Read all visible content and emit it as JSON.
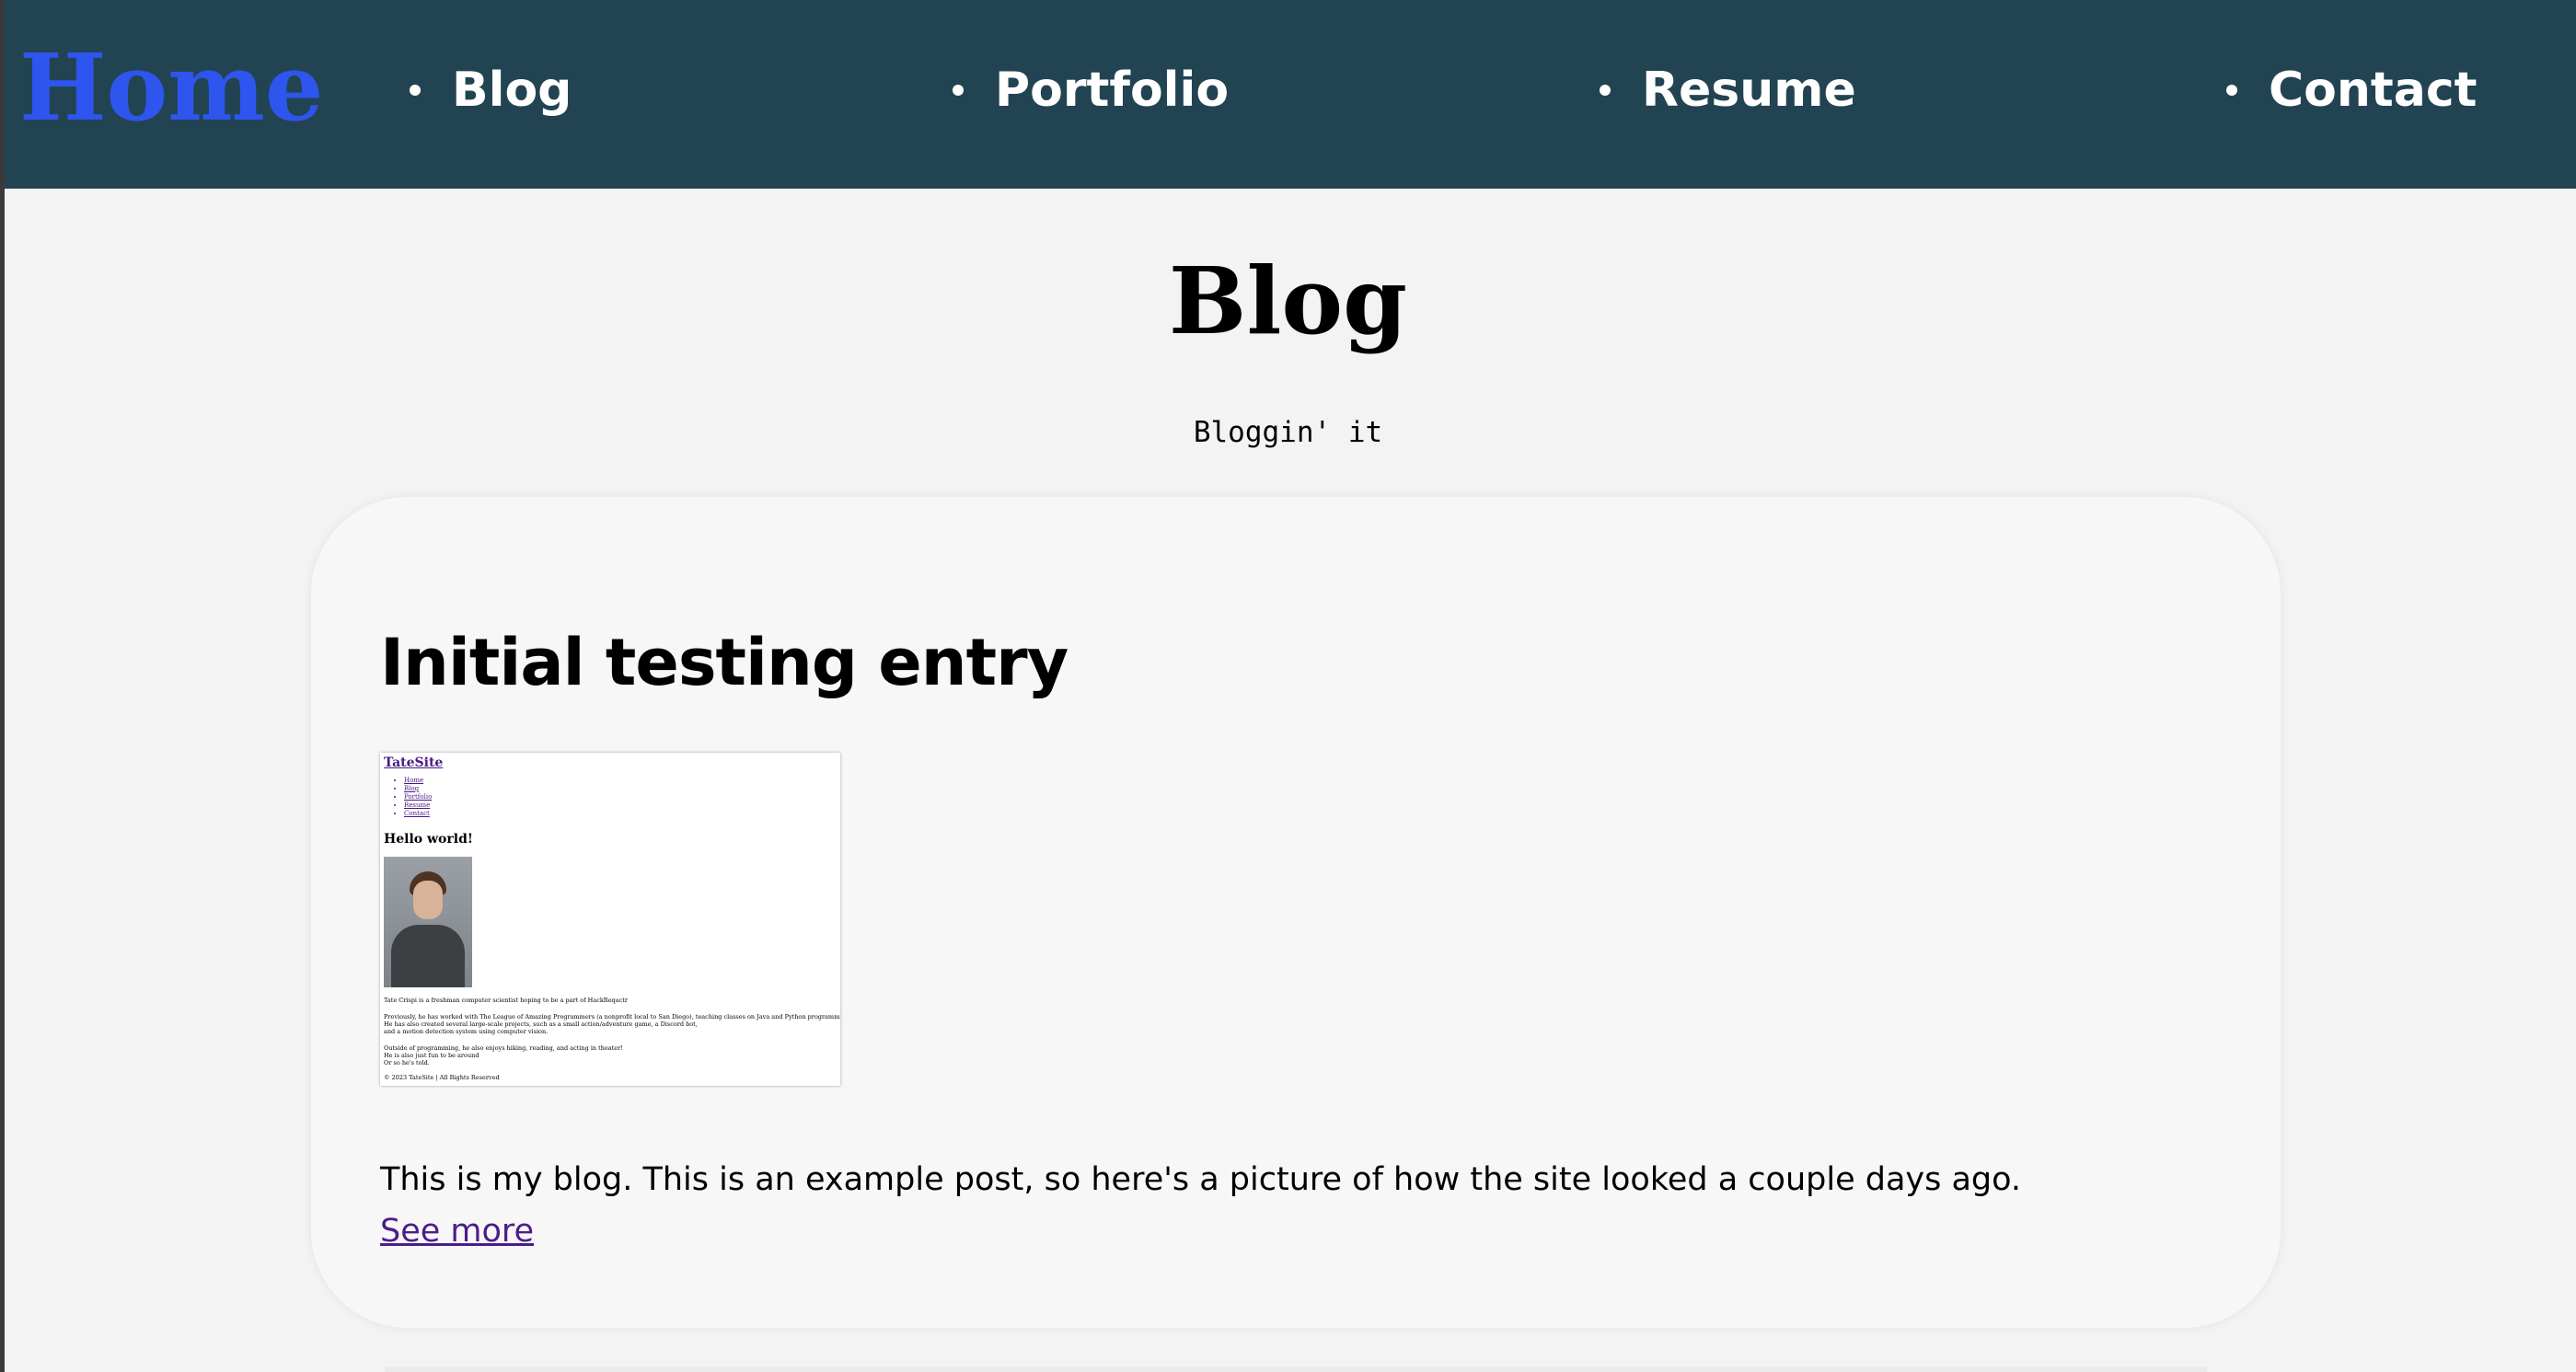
{
  "nav": {
    "home": "Home",
    "items": [
      {
        "label": "Blog"
      },
      {
        "label": "Portfolio"
      },
      {
        "label": "Resume"
      },
      {
        "label": "Contact"
      }
    ]
  },
  "page": {
    "title": "Blog",
    "subtitle": "Bloggin' it"
  },
  "post": {
    "title": "Initial testing entry",
    "body": "This is my blog. This is an example post, so here's a picture of how the site looked a couple days ago.",
    "link": "See more"
  },
  "screenshot": {
    "site_name": "TateSite",
    "nav": [
      "Home",
      "Blog",
      "Portfolio",
      "Resume",
      "Contact"
    ],
    "heading": "Hello world!",
    "lines": [
      "Tate Crispi is a freshman computer scientist hoping to be a part of HackReqactr",
      "Previously, he has worked with The League of Amazing Programmers (a nonprofit local to San Diego), teaching classes on Java and Python programming.",
      "He has also created several large-scale projects, such as a small action/adventure game, a Discord bot,",
      "and a motion detection system using computer vision.",
      "Outside of programming, he also enjoys hiking, reading, and acting in theater!",
      "He is also just fun to be around",
      "Or so he's told.",
      "© 2023 TateSite | All Rights Reserved"
    ]
  },
  "colors": {
    "navbar": "#224452",
    "home_link": "#2e55ee",
    "page_bg": "#f3f3f3",
    "card_bg": "#f7f7f7",
    "visited_link": "#4c1d8a"
  }
}
